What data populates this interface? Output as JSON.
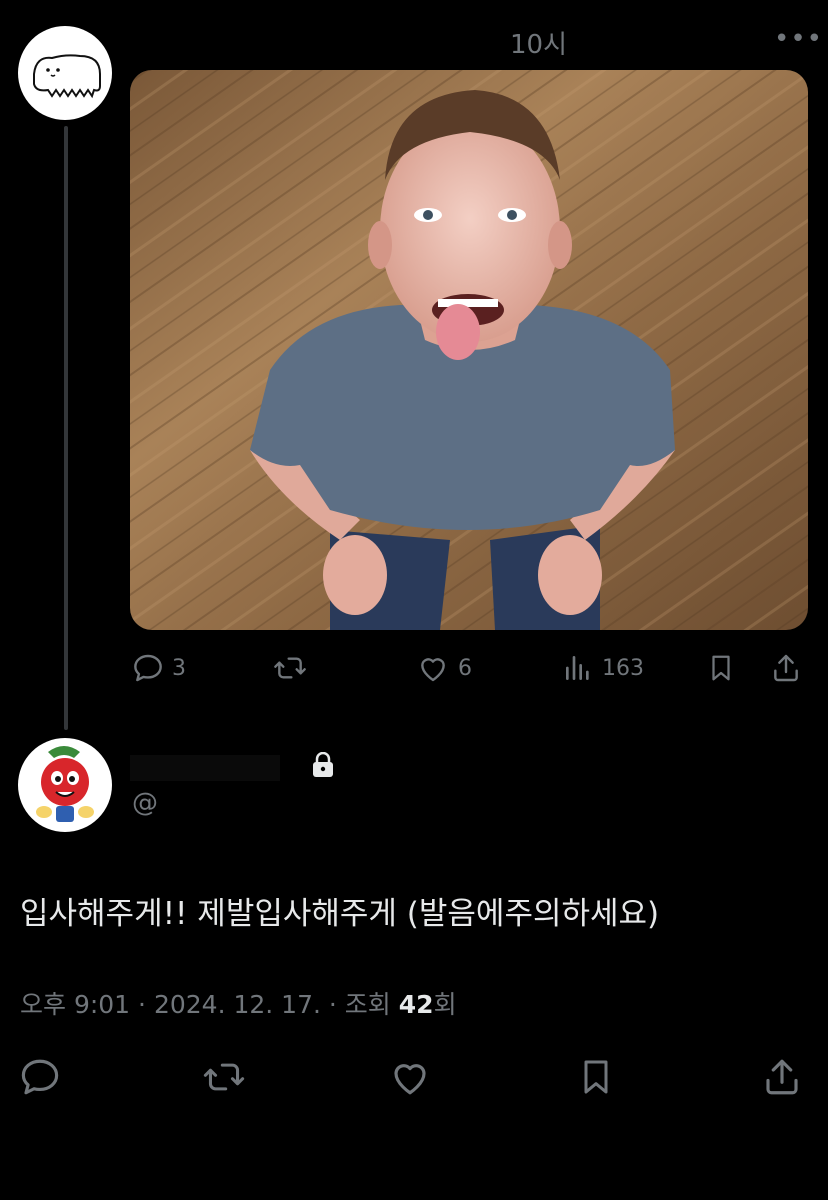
{
  "parent_tweet": {
    "time_partial": "10시",
    "more_label": "•••",
    "stats": {
      "replies": "3",
      "likes": "6",
      "views": "163"
    }
  },
  "reply": {
    "handle_prefix": "@",
    "text": "입사해주게!! 제발입사해주게 (발음에주의하세요)",
    "meta": {
      "time": "오후 9:01",
      "sep": "·",
      "date": "2024. 12. 17.",
      "views_label_pre": "조회",
      "views_count": "42",
      "views_label_post": "회"
    }
  },
  "icons": [
    "reply-icon",
    "retweet-icon",
    "like-icon",
    "views-icon",
    "bookmark-icon",
    "share-icon",
    "lock-icon",
    "more-icon"
  ],
  "colors": {
    "background": "#000000",
    "text": "#e7e9ea",
    "muted": "#71767b",
    "thread_line": "#333639"
  }
}
